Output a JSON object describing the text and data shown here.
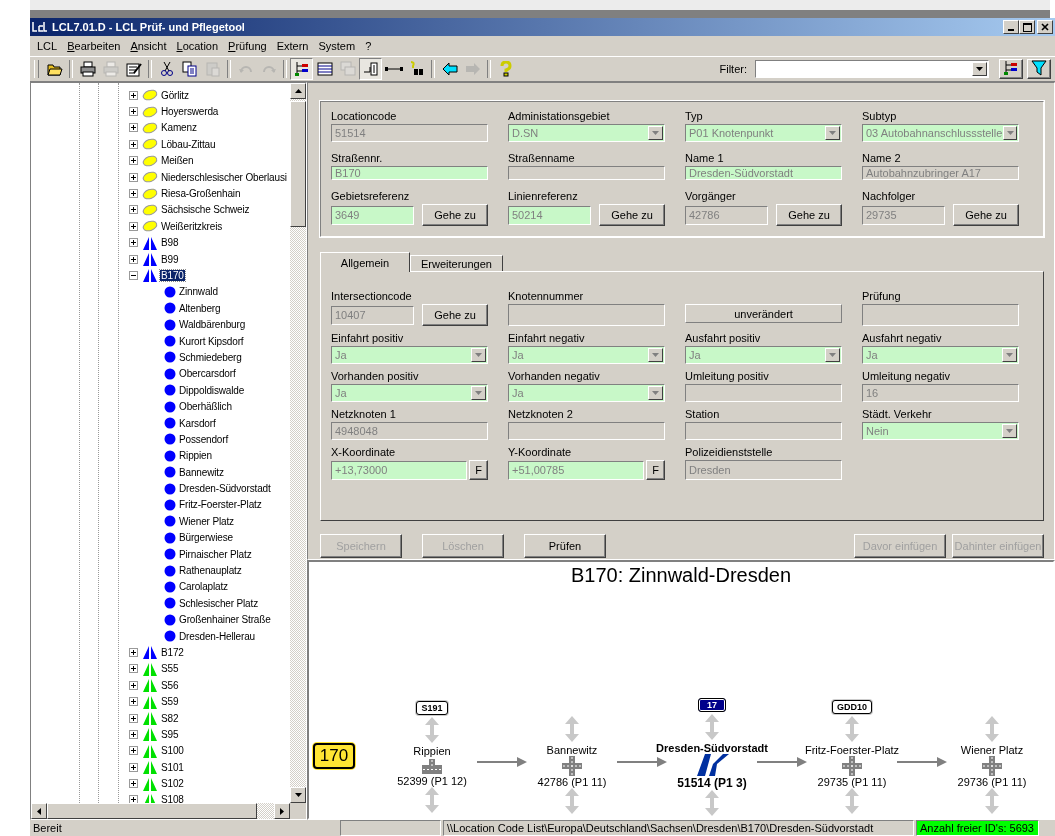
{
  "window": {
    "title": "LCL7.01.D - LCL Prüf- und Pflegetool"
  },
  "menu": [
    {
      "label": "LCL",
      "underline": false
    },
    {
      "label": "Bearbeiten",
      "underline": true
    },
    {
      "label": "Ansicht",
      "underline": true
    },
    {
      "label": "Location",
      "underline": true
    },
    {
      "label": "Prüfung",
      "underline": true
    },
    {
      "label": "Extern",
      "underline": false
    },
    {
      "label": "System",
      "underline": false
    },
    {
      "label": "?",
      "underline": true
    }
  ],
  "toolbar": {
    "buttons": [
      {
        "kind": "open",
        "pressed": false,
        "disabled": false
      },
      {
        "kind": "sep"
      },
      {
        "kind": "print",
        "pressed": false,
        "disabled": false
      },
      {
        "kind": "print",
        "pressed": false,
        "disabled": true
      },
      {
        "kind": "edit",
        "pressed": false,
        "disabled": false
      },
      {
        "kind": "sep"
      },
      {
        "kind": "cut",
        "pressed": false,
        "disabled": false
      },
      {
        "kind": "copy",
        "pressed": false,
        "disabled": false
      },
      {
        "kind": "paste",
        "pressed": false,
        "disabled": true
      },
      {
        "kind": "sep"
      },
      {
        "kind": "undo",
        "pressed": false,
        "disabled": true
      },
      {
        "kind": "redo",
        "pressed": false,
        "disabled": true
      },
      {
        "kind": "sep"
      },
      {
        "kind": "tree",
        "pressed": true,
        "disabled": false
      },
      {
        "kind": "table",
        "pressed": false,
        "disabled": false
      },
      {
        "kind": "windows",
        "pressed": false,
        "disabled": true
      },
      {
        "kind": "link",
        "pressed": true,
        "disabled": false
      },
      {
        "kind": "connect",
        "pressed": false,
        "disabled": false
      },
      {
        "kind": "find",
        "pressed": false,
        "disabled": false
      },
      {
        "kind": "sep"
      },
      {
        "kind": "back",
        "pressed": false,
        "disabled": false
      },
      {
        "kind": "forward",
        "pressed": false,
        "disabled": true
      },
      {
        "kind": "sep"
      },
      {
        "kind": "help",
        "pressed": false,
        "disabled": false
      }
    ],
    "filter_label": "Filter:"
  },
  "tree": {
    "items": [
      {
        "kind": "district",
        "label": "Görlitz",
        "expanded": false,
        "selected": false
      },
      {
        "kind": "district",
        "label": "Hoyerswerda",
        "expanded": false,
        "selected": false
      },
      {
        "kind": "district",
        "label": "Kamenz",
        "expanded": false,
        "selected": false
      },
      {
        "kind": "district",
        "label": "Löbau-Zittau",
        "expanded": false,
        "selected": false
      },
      {
        "kind": "district",
        "label": "Meißen",
        "expanded": false,
        "selected": false
      },
      {
        "kind": "district",
        "label": "Niederschlesischer Oberlausi",
        "expanded": false,
        "selected": false
      },
      {
        "kind": "district",
        "label": "Riesa-Großenhain",
        "expanded": false,
        "selected": false
      },
      {
        "kind": "district",
        "label": "Sächsische Schweiz",
        "expanded": false,
        "selected": false
      },
      {
        "kind": "district",
        "label": "Weißeritzkreis",
        "expanded": false,
        "selected": false
      },
      {
        "kind": "federal-road",
        "label": "B98",
        "expanded": false,
        "selected": false
      },
      {
        "kind": "federal-road",
        "label": "B99",
        "expanded": false,
        "selected": false
      },
      {
        "kind": "federal-road",
        "label": "B170",
        "expanded": true,
        "selected": true,
        "children": [
          {
            "kind": "location",
            "label": "Zinnwald",
            "selected": false
          },
          {
            "kind": "location",
            "label": "Altenberg",
            "selected": false
          },
          {
            "kind": "location",
            "label": "Waldbärenburg",
            "selected": false
          },
          {
            "kind": "location",
            "label": "Kurort Kipsdorf",
            "selected": false
          },
          {
            "kind": "location",
            "label": "Schmiedeberg",
            "selected": false
          },
          {
            "kind": "location",
            "label": "Obercarsdorf",
            "selected": false
          },
          {
            "kind": "location",
            "label": "Dippoldiswalde",
            "selected": false
          },
          {
            "kind": "location",
            "label": "Oberhäßlich",
            "selected": false
          },
          {
            "kind": "location",
            "label": "Karsdorf",
            "selected": false
          },
          {
            "kind": "location",
            "label": "Possendorf",
            "selected": false
          },
          {
            "kind": "location",
            "label": "Rippien",
            "selected": false
          },
          {
            "kind": "location",
            "label": "Bannewitz",
            "selected": false
          },
          {
            "kind": "location",
            "label": "Dresden-Südvorstadt",
            "selected": false
          },
          {
            "kind": "location",
            "label": "Fritz-Foerster-Platz",
            "selected": false
          },
          {
            "kind": "location",
            "label": "Wiener Platz",
            "selected": false
          },
          {
            "kind": "location",
            "label": "Bürgerwiese",
            "selected": false
          },
          {
            "kind": "location",
            "label": "Pirnaischer Platz",
            "selected": false
          },
          {
            "kind": "location",
            "label": "Rathenauplatz",
            "selected": false
          },
          {
            "kind": "location",
            "label": "Carolaplatz",
            "selected": false
          },
          {
            "kind": "location",
            "label": "Schlesischer Platz",
            "selected": false
          },
          {
            "kind": "location",
            "label": "Großenhainer Straße",
            "selected": false
          },
          {
            "kind": "location",
            "label": "Dresden-Hellerau",
            "selected": false
          }
        ]
      },
      {
        "kind": "federal-road",
        "label": "B172",
        "expanded": false,
        "selected": false
      },
      {
        "kind": "state-road",
        "label": "S55",
        "expanded": false,
        "selected": false
      },
      {
        "kind": "state-road",
        "label": "S56",
        "expanded": false,
        "selected": false
      },
      {
        "kind": "state-road",
        "label": "S59",
        "expanded": false,
        "selected": false
      },
      {
        "kind": "state-road",
        "label": "S82",
        "expanded": false,
        "selected": false
      },
      {
        "kind": "state-road",
        "label": "S95",
        "expanded": false,
        "selected": false
      },
      {
        "kind": "state-road",
        "label": "S100",
        "expanded": false,
        "selected": false
      },
      {
        "kind": "state-road",
        "label": "S101",
        "expanded": false,
        "selected": false
      },
      {
        "kind": "state-road",
        "label": "S102",
        "expanded": false,
        "selected": false
      },
      {
        "kind": "state-road",
        "label": "S108",
        "expanded": false,
        "selected": false
      }
    ]
  },
  "header_fields": [
    {
      "kind": "text",
      "label": "Locationcode",
      "value": "51514",
      "highlighted": false
    },
    {
      "kind": "combo",
      "label": "Administationsgebiet",
      "value": "D.SN",
      "highlighted": true
    },
    {
      "kind": "combo",
      "label": "Typ",
      "value": "P01 Knotenpunkt",
      "highlighted": true
    },
    {
      "kind": "combo",
      "label": "Subtyp",
      "value": "03 Autobahnanschlussstelle",
      "highlighted": true
    },
    {
      "kind": "text",
      "label": "Straßennr.",
      "value": "B170",
      "highlighted": true
    },
    {
      "kind": "text",
      "label": "Straßenname",
      "highlighted": false
    },
    {
      "kind": "text",
      "label": "Name 1",
      "value": "Dresden-Südvorstadt",
      "highlighted": true
    },
    {
      "kind": "text",
      "label": "Name 2",
      "value": "Autobahnzubringer A17",
      "highlighted": false
    },
    {
      "kind": "goto",
      "label": "Gebietsreferenz",
      "value": "3649",
      "highlighted": true,
      "button": "Gehe zu"
    },
    {
      "kind": "goto",
      "label": "Linienreferenz",
      "value": "50214",
      "highlighted": true,
      "button": "Gehe zu"
    },
    {
      "kind": "goto",
      "label": "Vorgänger",
      "value": "42786",
      "highlighted": false,
      "button": "Gehe zu"
    },
    {
      "kind": "goto",
      "label": "Nachfolger",
      "value": "29735",
      "highlighted": false,
      "button": "Gehe zu"
    }
  ],
  "tabs": [
    {
      "label": "Allgemein",
      "selected": true
    },
    {
      "label": "Erweiterungen",
      "selected": false
    }
  ],
  "tab_fields": [
    {
      "kind": "goto",
      "label": "Intersectioncode",
      "value": "10407",
      "highlighted": false,
      "button": "Gehe zu"
    },
    {
      "kind": "text",
      "label": "Knotennummer",
      "highlighted": false
    },
    {
      "kind": "status",
      "button": "unverändert"
    },
    {
      "kind": "text",
      "label": "Prüfung",
      "highlighted": false
    },
    {
      "kind": "combo",
      "label": "Einfahrt positiv",
      "value": "Ja",
      "highlighted": true
    },
    {
      "kind": "combo",
      "label": "Einfahrt negativ",
      "value": "Ja",
      "highlighted": true
    },
    {
      "kind": "combo",
      "label": "Ausfahrt positiv",
      "value": "Ja",
      "highlighted": true
    },
    {
      "kind": "combo",
      "label": "Ausfahrt negativ",
      "value": "Ja",
      "highlighted": true
    },
    {
      "kind": "combo",
      "label": "Vorhanden positiv",
      "value": "Ja",
      "highlighted": true
    },
    {
      "kind": "combo",
      "label": "Vorhanden negativ",
      "value": "Ja",
      "highlighted": true
    },
    {
      "kind": "text",
      "label": "Umleitung positiv",
      "highlighted": false
    },
    {
      "kind": "text",
      "label": "Umleitung negativ",
      "value": "16",
      "highlighted": false
    },
    {
      "kind": "text",
      "label": "Netzknoten 1",
      "value": "4948048",
      "highlighted": false
    },
    {
      "kind": "text",
      "label": "Netzknoten 2",
      "highlighted": false
    },
    {
      "kind": "text",
      "label": "Station",
      "highlighted": false
    },
    {
      "kind": "combo",
      "label": "Städt. Verkehr",
      "value": "Nein",
      "highlighted": true
    },
    {
      "kind": "coord",
      "label": "X-Koordinate",
      "value": "+13,73000",
      "highlighted": true,
      "button": "F"
    },
    {
      "kind": "coord",
      "label": "Y-Koordinate",
      "value": "+51,00785",
      "highlighted": true,
      "button": "F"
    },
    {
      "kind": "text",
      "label": "Polizeidienststelle",
      "value": "Dresden",
      "highlighted": false
    }
  ],
  "actions": [
    {
      "label": "Speichern",
      "disabled": true
    },
    {
      "label": "Löschen",
      "disabled": true
    },
    {
      "label": "Prüfen",
      "disabled": false
    },
    {
      "label": "Davor einfügen",
      "disabled": true
    },
    {
      "label": "Dahinter einfügen",
      "disabled": true
    }
  ],
  "diagram": {
    "title": "B170: Zinnwald-Dresden",
    "road_number": "170",
    "nodes": [
      {
        "name": "Rippien",
        "code": "52399 (P1 12)",
        "kind": "t-junction",
        "current": false,
        "sign": {
          "text": "S191",
          "kind": "state"
        }
      },
      {
        "name": "Bannewitz",
        "code": "42786 (P1 11)",
        "kind": "crossroads",
        "current": false
      },
      {
        "name": "Dresden-Südvorstadt",
        "code": "51514 (P1 3)",
        "kind": "motorway-exit",
        "current": true,
        "sign": {
          "text": "17",
          "kind": "motorway"
        }
      },
      {
        "name": "Fritz-Foerster-Platz",
        "code": "29735 (P1 11)",
        "kind": "crossroads",
        "current": false,
        "sign": {
          "text": "GDD10",
          "kind": "state"
        }
      },
      {
        "name": "Wiener Platz",
        "code": "29736 (P1 11)",
        "kind": "crossroads",
        "current": false
      }
    ]
  },
  "status_bar": {
    "message": "Bereit",
    "path": "\\\\Location Code List\\Europa\\Deutschland\\Sachsen\\Dresden\\B170\\Dresden-Südvorstadt",
    "free_ids": "Anzahl freier ID's: 5693"
  }
}
